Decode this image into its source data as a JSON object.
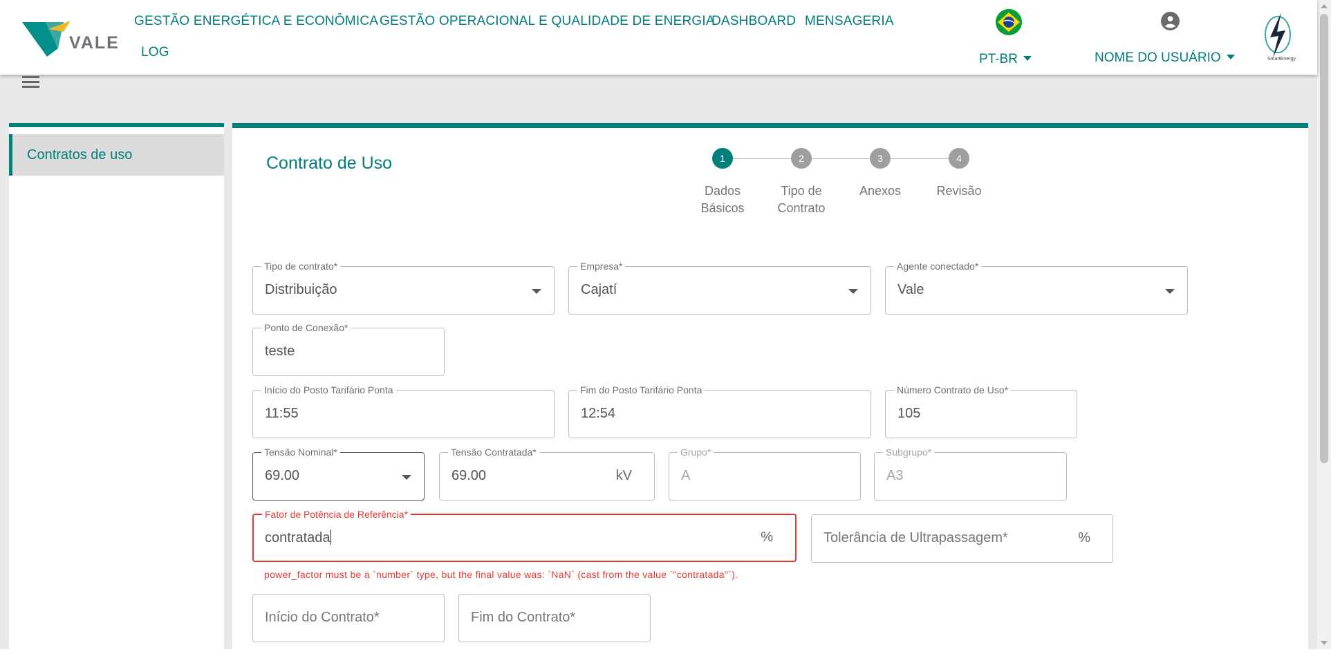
{
  "header": {
    "logo_text": "VALE",
    "nav": [
      "GESTÃO ENERGÉTICA E ECONÔMICA",
      "GESTÃO OPERACIONAL E QUALIDADE DE ENERGIA",
      "DASHBOARD",
      "MENSAGERIA",
      "LOG"
    ],
    "language": "PT-BR",
    "user_name": "NOME DO USUÁRIO",
    "brand_text": "SmartEnergy"
  },
  "sidebar": {
    "items": [
      {
        "label": "Contratos de uso",
        "active": true
      }
    ]
  },
  "main": {
    "title": "Contrato de Uso",
    "stepper": [
      {
        "number": "1",
        "label_line1": "Dados",
        "label_line2": "Básicos",
        "active": true
      },
      {
        "number": "2",
        "label_line1": "Tipo de",
        "label_line2": "Contrato",
        "active": false
      },
      {
        "number": "3",
        "label_line1": "Anexos",
        "label_line2": "",
        "active": false
      },
      {
        "number": "4",
        "label_line1": "Revisão",
        "label_line2": "",
        "active": false
      }
    ],
    "fields": {
      "tipo_contrato": {
        "label": "Tipo de contrato*",
        "value": "Distribuição"
      },
      "empresa": {
        "label": "Empresa*",
        "value": "Cajatí"
      },
      "agente_conectado": {
        "label": "Agente conectado*",
        "value": "Vale"
      },
      "ponto_conexao": {
        "label": "Ponto de Conexão*",
        "value": "teste"
      },
      "inicio_posto": {
        "label": "Início do Posto Tarifário Ponta",
        "value": "11:55"
      },
      "fim_posto": {
        "label": "Fim do Posto Tarifário Ponta",
        "value": "12:54"
      },
      "numero_contrato": {
        "label": "Número Contrato de Uso*",
        "value": "105"
      },
      "tensao_nominal": {
        "label": "Tensão Nominal*",
        "value": "69.00"
      },
      "tensao_contratada": {
        "label": "Tensão Contratada*",
        "value": "69.00",
        "unit": "kV"
      },
      "grupo": {
        "label": "Grupo*",
        "value": "A"
      },
      "subgrupo": {
        "label": "Subgrupo*",
        "value": "A3"
      },
      "fator_potencia": {
        "label": "Fator de Potência de Referência*",
        "value": "contratada",
        "unit": "%"
      },
      "tolerancia": {
        "placeholder": "Tolerância de Ultrapassagem*",
        "unit": "%"
      },
      "inicio_contrato": {
        "placeholder": "Início do Contrato*"
      },
      "fim_contrato": {
        "placeholder": "Fim do Contrato*"
      }
    },
    "error_message": "power_factor must be a `number` type, but the final value was: `NaN` (cast from the value `\"contratada\"`)."
  },
  "colors": {
    "accent": "#007e7a",
    "error": "#e53935",
    "step_inactive": "#9e9e9e"
  }
}
